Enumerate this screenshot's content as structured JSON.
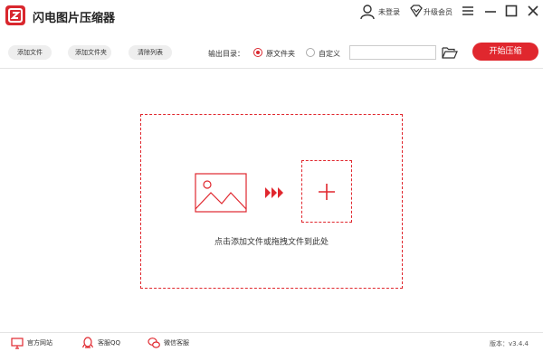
{
  "app": {
    "title": "闪电图片压缩器"
  },
  "titlebar": {
    "login_label": "未登录",
    "vip_label": "升级会员"
  },
  "toolbar": {
    "add_file": "添加文件",
    "add_folder": "添加文件夹",
    "clear_list": "清除列表",
    "output_label": "输出目录：",
    "option_original": "原文件夹",
    "option_custom": "自定义",
    "selected_option": "原文件夹",
    "path_value": "",
    "start_label": "开始压缩"
  },
  "dropzone": {
    "hint": "点击添加文件或拖拽文件到此处"
  },
  "footer": {
    "website": "官方网站",
    "qq_service": "客服QQ",
    "wechat_service": "微信客服",
    "version": "版本：v3.4.4"
  },
  "colors": {
    "accent": "#e0272e",
    "button_bg": "#eeeeee"
  },
  "icons": [
    "logo-icon",
    "user-icon",
    "vip-icon",
    "menu-icon",
    "minimize-icon",
    "maximize-icon",
    "close-icon",
    "folder-icon",
    "image-icon",
    "arrows-icon",
    "plus-icon",
    "monitor-icon",
    "qq-icon",
    "wechat-icon"
  ]
}
